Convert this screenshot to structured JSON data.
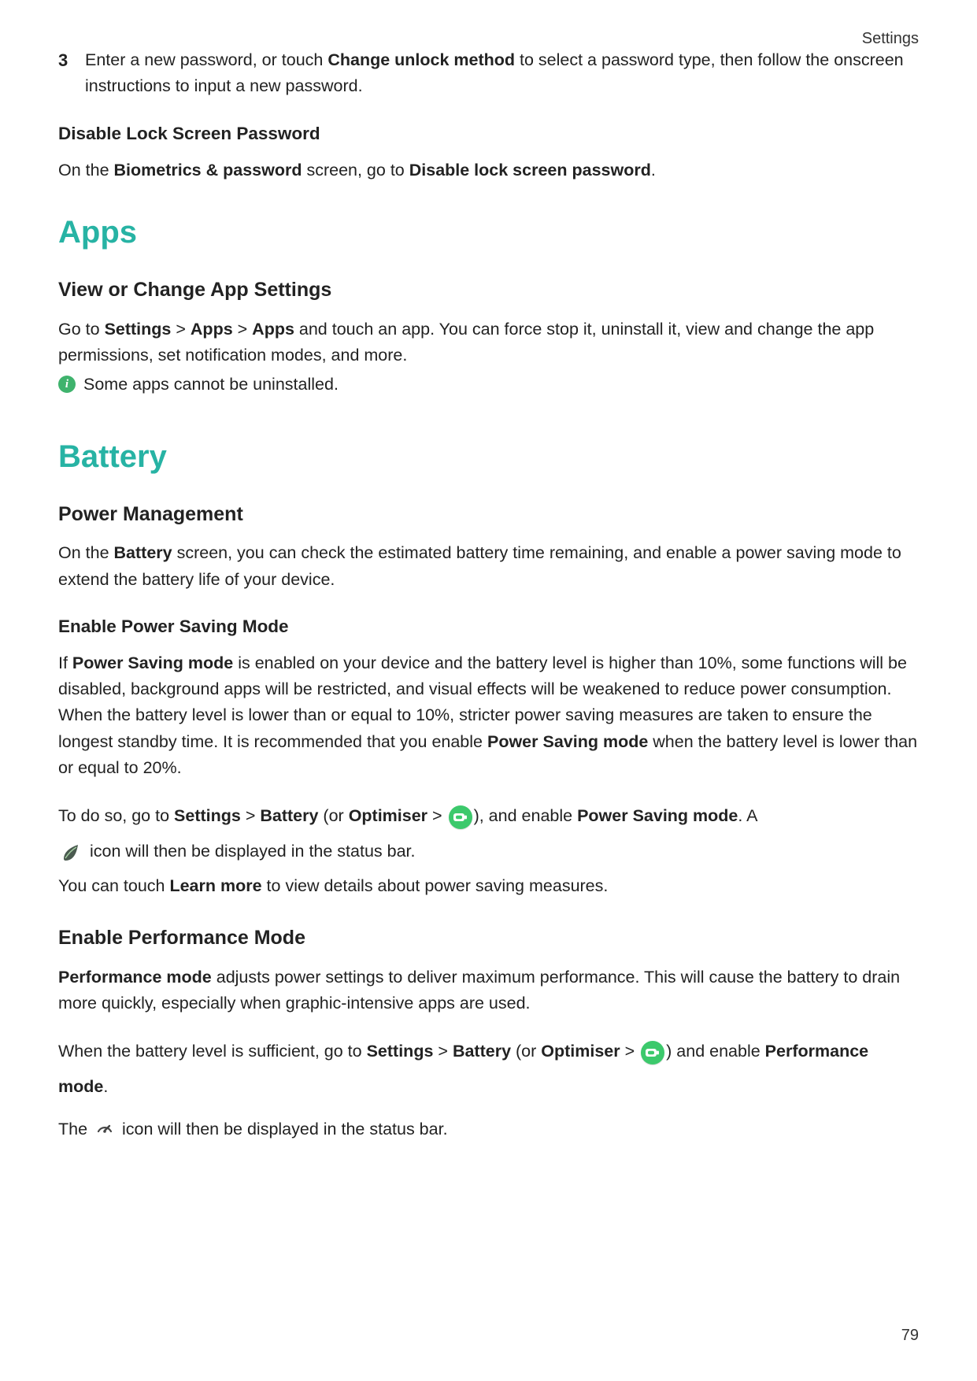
{
  "header": {
    "right_label": "Settings"
  },
  "footer": {
    "page_number": "79"
  },
  "step": {
    "number": "3",
    "text_before": "Enter a new password, or touch ",
    "bold1": "Change unlock method",
    "text_after": " to select a password type, then follow the onscreen instructions to input a new password."
  },
  "disable_lock": {
    "heading": "Disable Lock Screen Password",
    "line_a": "On the ",
    "bold_a": "Biometrics & password",
    "line_b": " screen, go to ",
    "bold_b": "Disable lock screen password",
    "line_c": "."
  },
  "apps": {
    "title": "Apps",
    "h2": "View or Change App Settings",
    "p1a": "Go to ",
    "p1b_bold": "Settings",
    "gt1": " > ",
    "p1c_bold": "Apps",
    "gt2": " > ",
    "p1d_bold": "Apps",
    "p1e": " and touch an app. You can force stop it, uninstall it, view and change the app permissions, set notification modes, and more.",
    "note_icon_label": "i",
    "note": "Some apps cannot be uninstalled."
  },
  "battery": {
    "title": "Battery",
    "pm_h2": "Power Management",
    "pm_a": "On the ",
    "pm_b_bold": "Battery",
    "pm_c": " screen, you can check the estimated battery time remaining, and enable a power saving mode to extend the battery life of your device.",
    "eps_h3": "Enable Power Saving Mode",
    "eps_a": "If ",
    "eps_b_bold": "Power Saving mode",
    "eps_c": " is enabled on your device and the battery level is higher than 10%, some functions will be disabled, background apps will be restricted, and visual effects will be weakened to reduce power consumption. When the battery level is lower than or equal to 10%, stricter power saving measures are taken to ensure the longest standby time. It is recommended that you enable ",
    "eps_d_bold": "Power Saving mode",
    "eps_e": " when the battery level is lower than or equal to 20%.",
    "eps2_a": "To do so, go to ",
    "eps2_settings": "Settings",
    "gt": " > ",
    "eps2_battery": "Battery",
    "eps2_or": " (or ",
    "eps2_optimiser": "Optimiser",
    "eps2_close": "), and enable ",
    "eps2_psm": "Power Saving mode",
    "eps2_dot_a": ". A",
    "eps3": " icon will then be displayed in the status bar.",
    "eps4_a": "You can touch ",
    "eps4_learn": "Learn more",
    "eps4_b": " to view details about power saving measures.",
    "perf_h2": "Enable Performance Mode",
    "perf1_a_bold": "Performance mode",
    "perf1_b": " adjusts power settings to deliver maximum performance. This will cause the battery to drain more quickly, especially when graphic-intensive apps are used.",
    "perf2_a": "When the battery level is sufficient, go to ",
    "perf2_settings": "Settings",
    "perf2_battery": "Battery",
    "perf2_or": " (or ",
    "perf2_optimiser": "Optimiser",
    "perf2_close": ") and enable ",
    "perf2_pm": "Performance mode",
    "perf2_dot": ".",
    "perf3_a": "The ",
    "perf3_b": " icon will then be displayed in the status bar."
  }
}
